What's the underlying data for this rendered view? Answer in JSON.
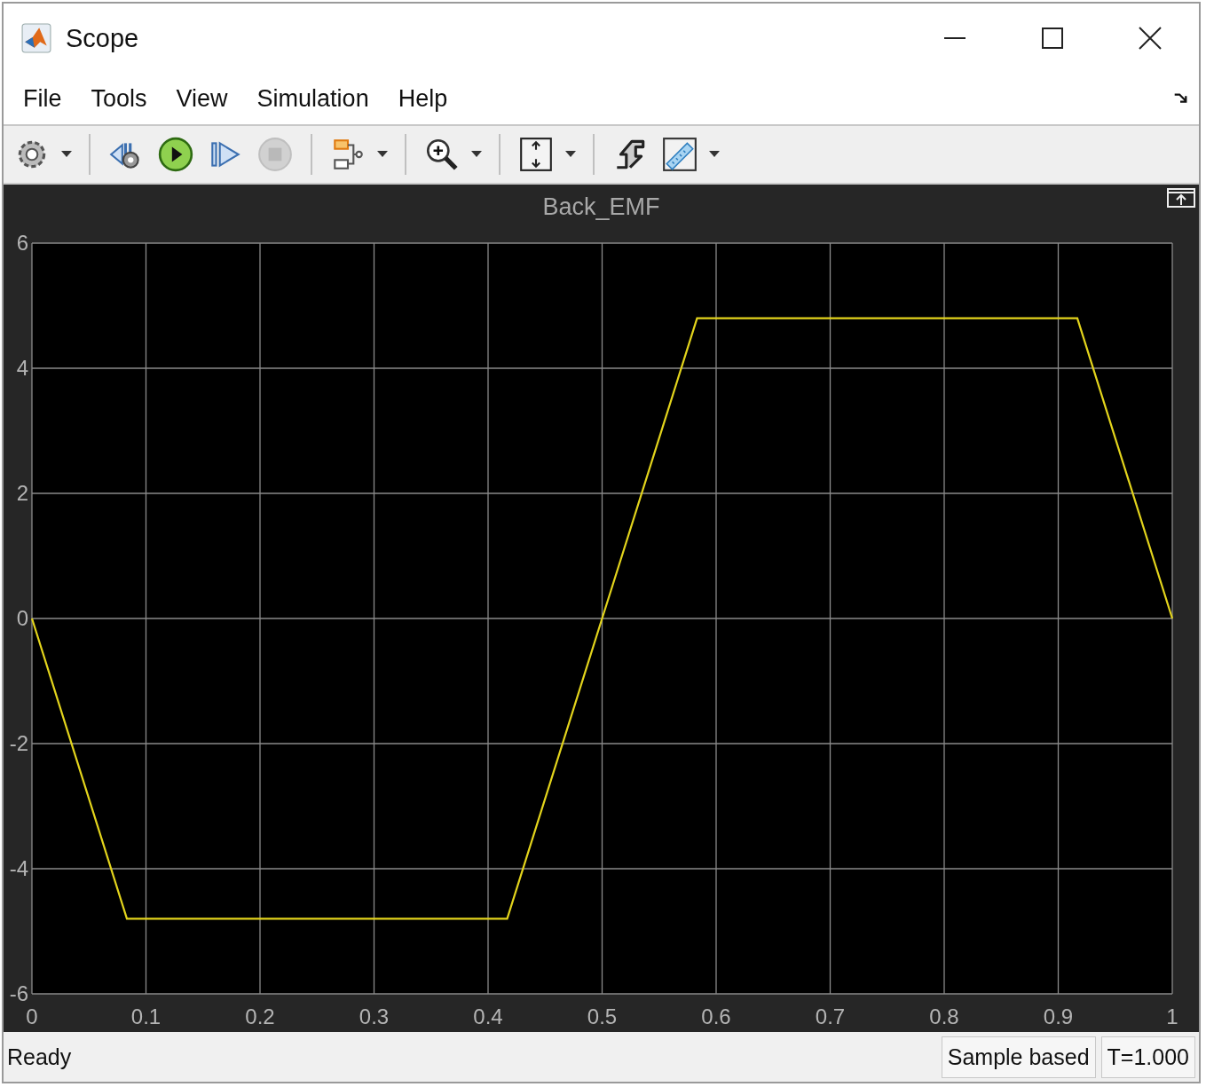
{
  "window": {
    "title": "Scope"
  },
  "menu": [
    "File",
    "Tools",
    "View",
    "Simulation",
    "Help"
  ],
  "toolbar": [
    [
      {
        "kind": "settings",
        "dropdown": true,
        "disabled": false
      }
    ],
    [
      {
        "kind": "step-back",
        "dropdown": false,
        "disabled": false
      },
      {
        "kind": "run",
        "dropdown": false,
        "disabled": false
      },
      {
        "kind": "step-forward",
        "dropdown": false,
        "disabled": false
      },
      {
        "kind": "stop",
        "dropdown": false,
        "disabled": true
      }
    ],
    [
      {
        "kind": "blocks",
        "dropdown": true,
        "disabled": false
      }
    ],
    [
      {
        "kind": "zoom",
        "dropdown": true,
        "disabled": false
      }
    ],
    [
      {
        "kind": "scale",
        "dropdown": true,
        "disabled": false
      }
    ],
    [
      {
        "kind": "signal",
        "dropdown": false,
        "disabled": false
      },
      {
        "kind": "ruler",
        "dropdown": true,
        "disabled": false
      }
    ]
  ],
  "plot": {
    "chart_data": {
      "type": "line",
      "title": "Back_EMF",
      "x": [
        0,
        0.0833,
        0.4167,
        0.5,
        0.5833,
        0.9167,
        1
      ],
      "series": [
        {
          "color": "#e3d41c",
          "values": [
            0,
            -4.8,
            -4.8,
            0,
            4.8,
            4.8,
            0
          ]
        }
      ],
      "grid": true,
      "xlim": [
        0,
        1
      ],
      "ylim": [
        -6,
        6
      ],
      "xticks": [
        0,
        0.1,
        0.2,
        0.3,
        0.4,
        0.5,
        0.6,
        0.7,
        0.8,
        0.9,
        1
      ],
      "yticks": [
        -6,
        -4,
        -2,
        0,
        2,
        4,
        6
      ]
    }
  },
  "status_bar": {
    "message": "Ready",
    "mode": "Sample based",
    "time": "T=1.000"
  }
}
